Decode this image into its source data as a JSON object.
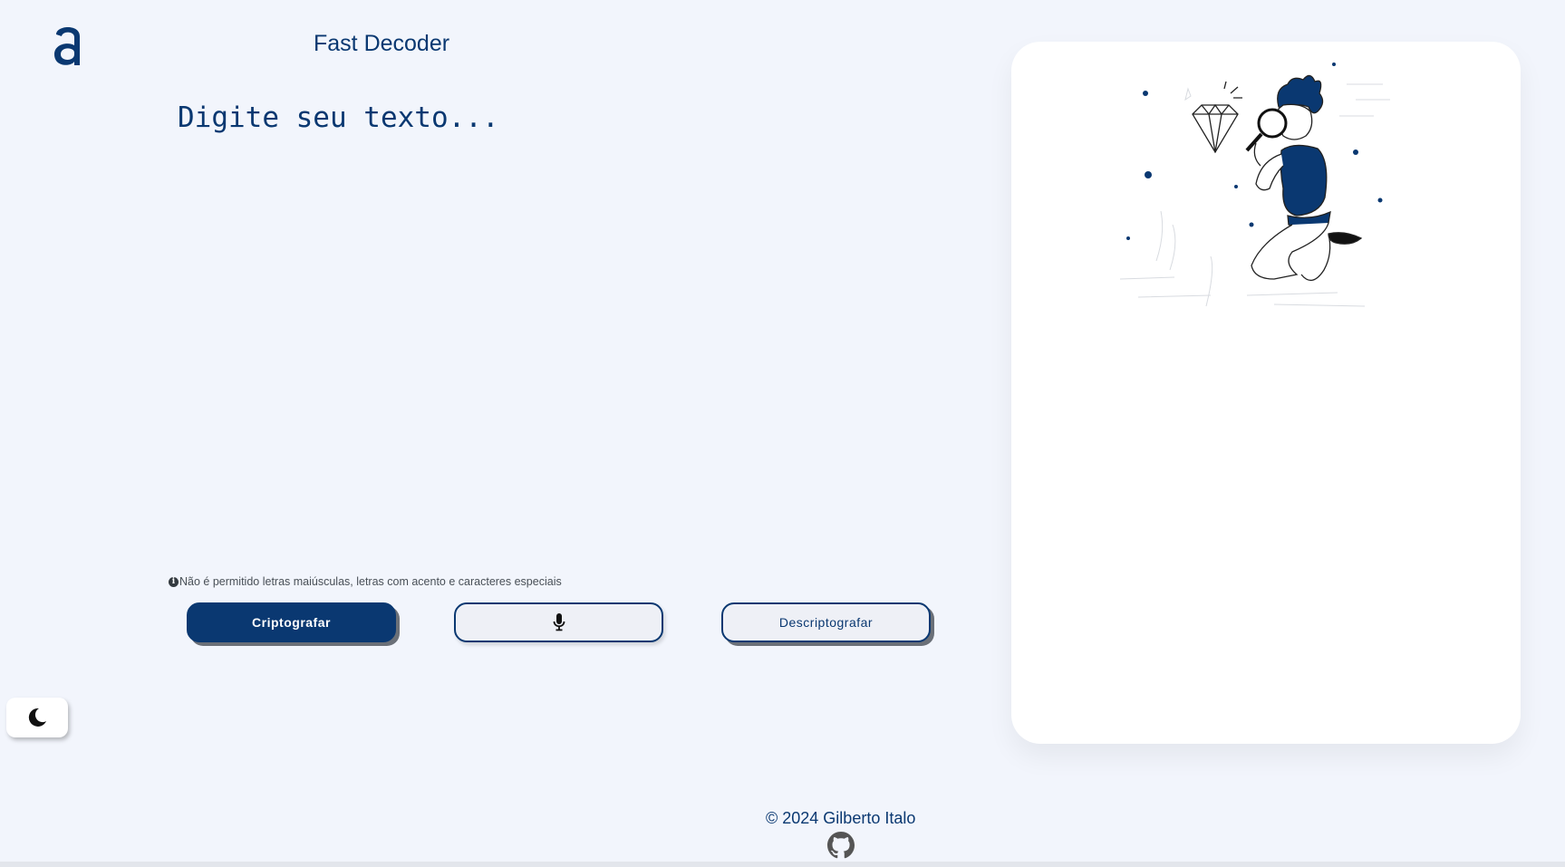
{
  "header": {
    "logo_icon": "alura-logo-icon",
    "title": "Fast Decoder"
  },
  "input": {
    "placeholder": "Digite seu texto...",
    "value": ""
  },
  "warning": {
    "icon": "info-icon",
    "text": "Não é permitido letras maiúsculas, letras com acento e caracteres especiais"
  },
  "buttons": {
    "encrypt_label": "Criptografar",
    "mic_icon": "microphone-icon",
    "decrypt_label": "Descriptografar"
  },
  "theme_toggle": {
    "icon": "moon-icon"
  },
  "output": {
    "illustration": "person-with-magnifying-glass-illustration"
  },
  "footer": {
    "copyright": "© 2024 Gilberto Italo",
    "github_icon": "github-icon"
  },
  "colors": {
    "background": "#f2f5fc",
    "primary": "#0a3871",
    "card": "#ffffff",
    "shadow": "#6b7078"
  }
}
